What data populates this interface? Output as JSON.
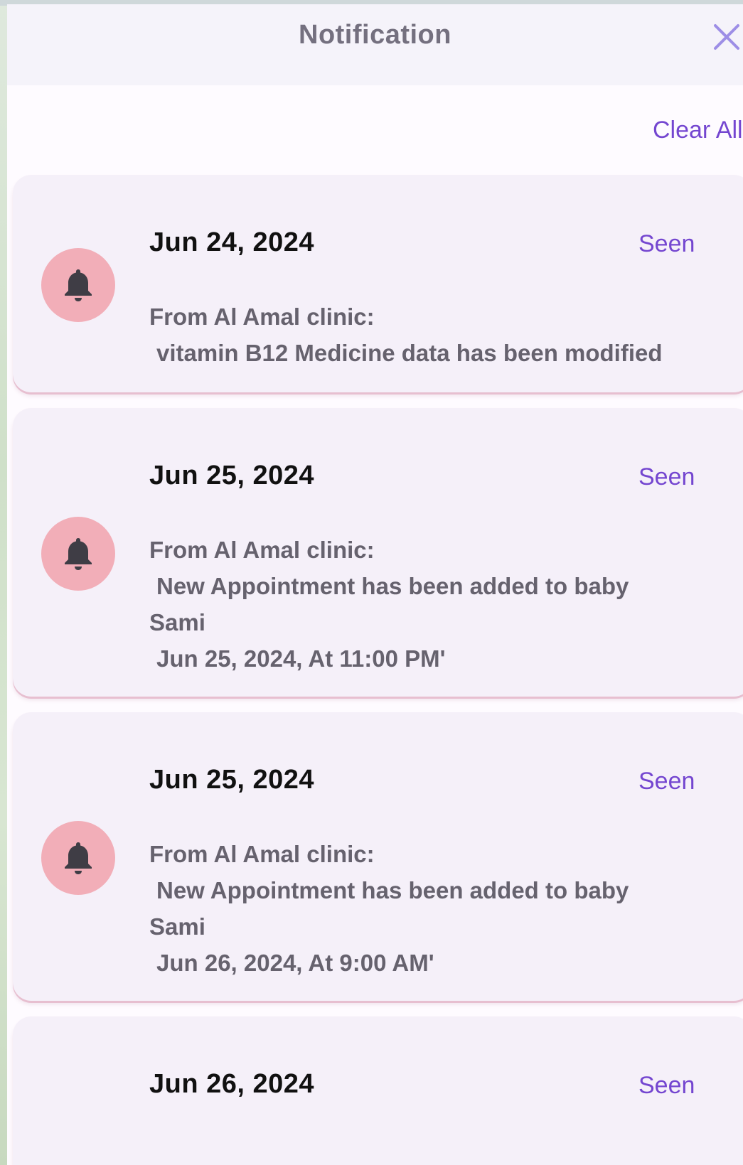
{
  "header": {
    "title": "Notification"
  },
  "actions": {
    "clear_all_label": "Clear All"
  },
  "notifications": [
    {
      "date": "Jun 24, 2024",
      "status": "Seen",
      "source": "From Al Amal clinic:",
      "lines": [
        "vitamin B12 Medicine data has been modified"
      ]
    },
    {
      "date": "Jun 25, 2024",
      "status": "Seen",
      "source": "From Al Amal clinic:",
      "lines": [
        "New Appointment has been added to baby",
        "Sami",
        "Jun 25, 2024,  At 11:00 PM'"
      ]
    },
    {
      "date": "Jun 25, 2024",
      "status": "Seen",
      "source": "From Al Amal clinic:",
      "lines": [
        "New Appointment has been added to baby",
        "Sami",
        "Jun 26, 2024,  At 9:00 AM'"
      ]
    },
    {
      "date": "Jun 26, 2024",
      "status": "Seen"
    }
  ],
  "colors": {
    "accent": "#7446d0",
    "bell_circle": "#f2aeb8",
    "card_bg": "#f5f0f9",
    "header_bg": "#f5f3fa"
  },
  "icons": {
    "close": "close-icon",
    "bell": "bell-icon"
  }
}
